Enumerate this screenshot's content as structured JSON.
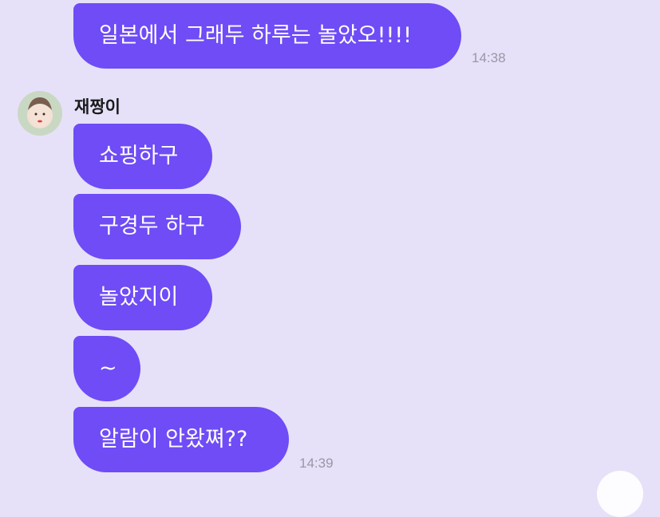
{
  "chat": {
    "prev_message": {
      "text": "일본에서 그래두 하루는 놀았오!!!!",
      "time": "14:38"
    },
    "sender": {
      "name": "재짱이"
    },
    "messages": [
      {
        "text": "쇼핑하구"
      },
      {
        "text": "구경두 하구"
      },
      {
        "text": "놀았지이"
      },
      {
        "text": "~"
      },
      {
        "text": "알람이 안왔쪄??"
      }
    ],
    "last_time": "14:39"
  },
  "colors": {
    "bubble": "#6f4cf6",
    "background": "#e6e1f8",
    "timestamp": "#9a97a6"
  }
}
